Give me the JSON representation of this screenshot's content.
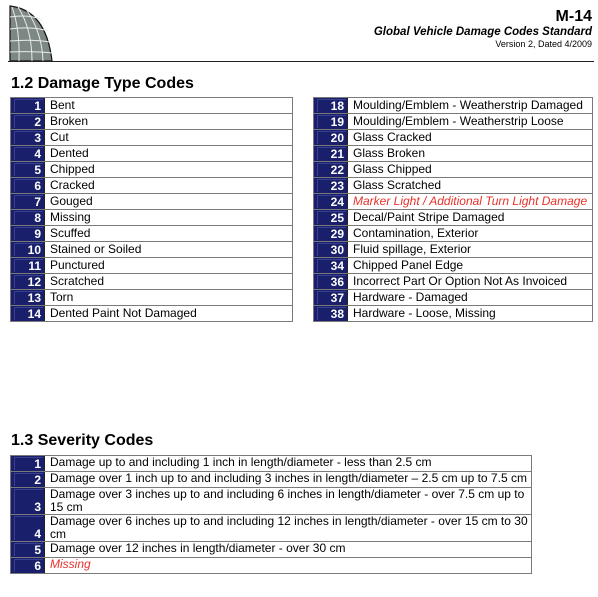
{
  "header": {
    "code": "M-14",
    "title": "Global Vehicle Damage Codes Standard",
    "version": "Version 2, Dated 4/2009"
  },
  "damage_type_section": {
    "title": "1.2 Damage Type Codes",
    "left": [
      {
        "code": "1",
        "label": "Bent"
      },
      {
        "code": "2",
        "label": "Broken"
      },
      {
        "code": "3",
        "label": "Cut"
      },
      {
        "code": "4",
        "label": "Dented"
      },
      {
        "code": "5",
        "label": "Chipped"
      },
      {
        "code": "6",
        "label": "Cracked"
      },
      {
        "code": "7",
        "label": "Gouged"
      },
      {
        "code": "8",
        "label": "Missing"
      },
      {
        "code": "9",
        "label": "Scuffed"
      },
      {
        "code": "10",
        "label": "Stained or Soiled"
      },
      {
        "code": "11",
        "label": "Punctured"
      },
      {
        "code": "12",
        "label": "Scratched"
      },
      {
        "code": "13",
        "label": "Torn"
      },
      {
        "code": "14",
        "label": "Dented Paint Not Damaged"
      }
    ],
    "right": [
      {
        "code": "18",
        "label": "Moulding/Emblem - Weatherstrip Damaged"
      },
      {
        "code": "19",
        "label": "Moulding/Emblem - Weatherstrip Loose"
      },
      {
        "code": "20",
        "label": "Glass Cracked"
      },
      {
        "code": "21",
        "label": "Glass Broken"
      },
      {
        "code": "22",
        "label": "Glass Chipped"
      },
      {
        "code": "23",
        "label": "Glass Scratched"
      },
      {
        "code": "24",
        "label": "Marker Light / Additional Turn Light Damage",
        "highlight": true
      },
      {
        "code": "25",
        "label": "Decal/Paint Stripe Damaged"
      },
      {
        "code": "29",
        "label": "Contamination, Exterior"
      },
      {
        "code": "30",
        "label": "Fluid spillage, Exterior"
      },
      {
        "code": "34",
        "label": "Chipped Panel Edge"
      },
      {
        "code": "36",
        "label": "Incorrect Part Or Option Not As Invoiced"
      },
      {
        "code": "37",
        "label": "Hardware - Damaged"
      },
      {
        "code": "38",
        "label": "Hardware - Loose, Missing"
      }
    ]
  },
  "severity_section": {
    "title": "1.3 Severity Codes",
    "rows": [
      {
        "code": "1",
        "label": "Damage up to and including 1 inch in length/diameter - less than 2.5 cm"
      },
      {
        "code": "2",
        "label": "Damage over 1 inch up to and including 3 inches in length/diameter – 2.5 cm up to 7.5 cm"
      },
      {
        "code": "3",
        "label": "Damage over 3 inches up to and including 6 inches in length/diameter - over 7.5 cm up to 15 cm"
      },
      {
        "code": "4",
        "label": "Damage over 6 inches up to and including 12 inches in length/diameter - over 15 cm to 30 cm"
      },
      {
        "code": "5",
        "label": "Damage over 12 inches in length/diameter - over 30 cm"
      },
      {
        "code": "6",
        "label": "Missing",
        "highlight": true
      }
    ]
  },
  "colors": {
    "code_cell_bg": "#1a1f6b",
    "highlight_text": "#e8312a",
    "logo_fill": "#7d8784"
  }
}
